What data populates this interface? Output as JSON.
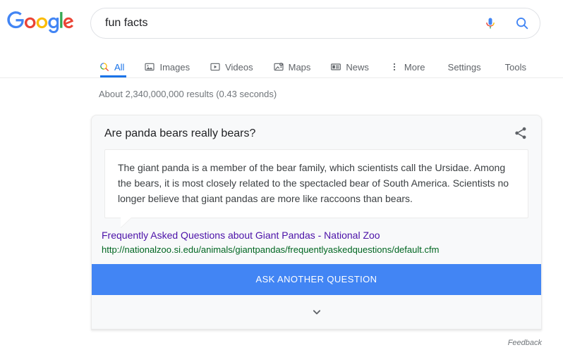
{
  "brand": {
    "name": "Google",
    "letters": [
      {
        "char": "G",
        "color": "#4285F4"
      },
      {
        "char": "o",
        "color": "#EA4335"
      },
      {
        "char": "o",
        "color": "#FBBC05"
      },
      {
        "char": "g",
        "color": "#4285F4"
      },
      {
        "char": "l",
        "color": "#34A853"
      },
      {
        "char": "e",
        "color": "#EA4335"
      }
    ]
  },
  "search": {
    "query": "fun facts",
    "placeholder": "Search",
    "mic_icon": "microphone-icon",
    "submit_icon": "search-icon"
  },
  "tabs": {
    "items": [
      {
        "label": "All",
        "icon": "search-icon",
        "active": true
      },
      {
        "label": "Images",
        "icon": "image-icon",
        "active": false
      },
      {
        "label": "Videos",
        "icon": "video-icon",
        "active": false
      },
      {
        "label": "Maps",
        "icon": "map-pin-icon",
        "active": false
      },
      {
        "label": "News",
        "icon": "newspaper-icon",
        "active": false
      },
      {
        "label": "More",
        "icon": "more-vertical-icon",
        "active": false
      }
    ],
    "settings_label": "Settings",
    "tools_label": "Tools"
  },
  "results": {
    "stats": "About 2,340,000,000 results (0.43 seconds)"
  },
  "answer_card": {
    "question": "Are panda bears really bears?",
    "share_icon": "share-icon",
    "answer": "The giant panda is a member of the bear family, which scientists call the Ursidae. Among the bears, it is most closely related to the spectacled bear of South America. Scientists no longer believe that giant pandas are more like raccoons than bears.",
    "source_title": "Frequently Asked Questions about Giant Pandas - National Zoo",
    "source_url": "http://nationalzoo.si.edu/animals/giantpandas/frequentlyaskedquestions/default.cfm",
    "ask_button_label": "ASK ANOTHER QUESTION",
    "expand_icon": "chevron-down-icon"
  },
  "footer": {
    "feedback_label": "Feedback"
  },
  "colors": {
    "accent_blue": "#4285f4",
    "link_purple": "#4b11a8",
    "url_green": "#006621",
    "card_bg": "#f8f9fa",
    "muted_text": "#70757a"
  }
}
